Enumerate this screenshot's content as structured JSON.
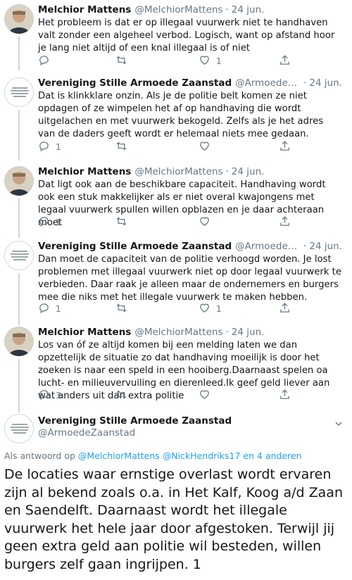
{
  "tweets": [
    {
      "name": "Melchior Mattens",
      "handle": "@MelchiorMattens",
      "date": "24 jun.",
      "text": "Het probleem is dat er op illegaal vuurwerk niet te handhaven valt zonder een algeheel verbod. Logisch, want op afstand hoor je lang niet altijd of een knal illegaal is of niet",
      "replies": "",
      "retweets": "",
      "likes": "1"
    },
    {
      "name": "Vereniging Stille Armoede Zaanstad",
      "handle": "@ArmoedeZaanst...",
      "date": "24 jun.",
      "text": "Dat is klinkklare onzin. Als je de politie belt komen ze niet opdagen of ze wimpelen het af op handhaving die wordt uitgelachen en met vuurwerk bekogeld. Zelfs als je het adres van de daders geeft wordt er helemaal niets mee gedaan.",
      "replies": "1",
      "retweets": "",
      "likes": ""
    },
    {
      "name": "Melchior Mattens",
      "handle": "@MelchiorMattens",
      "date": "24 jun.",
      "text": "Dat ligt ook aan de beschikbare capaciteit. Handhaving wordt ook een stuk makkelijker als er niet overal kwajongens met legaal vuurwerk spullen willen opblazen en je daar achteraan moet",
      "replies": "1",
      "retweets": "",
      "likes": ""
    },
    {
      "name": "Vereniging Stille Armoede Zaanstad",
      "handle": "@ArmoedeZaanst...",
      "date": "24 jun.",
      "text": "Dan moet de capaciteit van de politie verhoogd worden. Je lost problemen met illegaal vuurwerk niet op door legaal vuurwerk te verbieden. Daar raak je alleen maar de ondernemers en burgers mee die niks met het illegale vuurwerk te maken hebben.",
      "replies": "1",
      "retweets": "",
      "likes": "1"
    },
    {
      "name": "Melchior Mattens",
      "handle": "@MelchiorMattens",
      "date": "24 jun.",
      "text": "Los van óf ze altijd komen bij een melding laten we dan opzettelijk de situatie zo dat handhaving moeilijk is door het zoeken is naar een speld in een hooiberg.Daarnaast spelen oa lucht- en milieuvervuiling en dierenleed.Ik geef geld liever aan wat anders uit dan extra politie",
      "replies": "3",
      "retweets": "",
      "likes": ""
    }
  ],
  "focus": {
    "name": "Vereniging Stille Armoede Zaanstad",
    "handle": "@ArmoedeZaanstad",
    "reply_prefix": "Als antwoord op",
    "reply_mentions": "@MelchiorMattens @NickHendriks17",
    "reply_others": "en 4 anderen",
    "text": "De locaties waar ernstige overlast wordt ervaren zijn al bekend zoals o.a. in Het Kalf, Koog a/d Zaan en Saendelft. Daarnaast wordt het illegale vuurwerk het hele jaar door afgestoken. Terwijl jij geen extra geld aan politie wil besteden, willen burgers zelf gaan ingrijpen. 1"
  },
  "colors": {
    "secondary_text": "#657786",
    "link": "#1da1f2",
    "thread_line": "#ccd6dd"
  }
}
